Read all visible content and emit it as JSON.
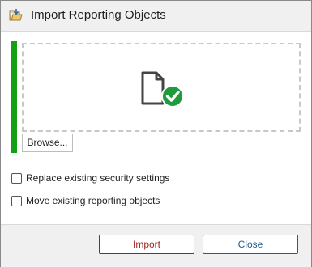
{
  "window": {
    "title": "Import Reporting Objects",
    "icon": "folder-import-icon"
  },
  "colors": {
    "accent_bar": "#14a014",
    "file_check": "#1e9b3a",
    "import_button": "#9e1f1f",
    "close_button": "#1f5e8f"
  },
  "drop_zone": {
    "icon": "file-check-icon",
    "browse_label": "Browse..."
  },
  "options": {
    "replace_security": {
      "label": "Replace existing security settings",
      "checked": false
    },
    "move_objects": {
      "label": "Move existing reporting objects",
      "checked": false
    }
  },
  "footer": {
    "import_label": "Import",
    "close_label": "Close"
  }
}
